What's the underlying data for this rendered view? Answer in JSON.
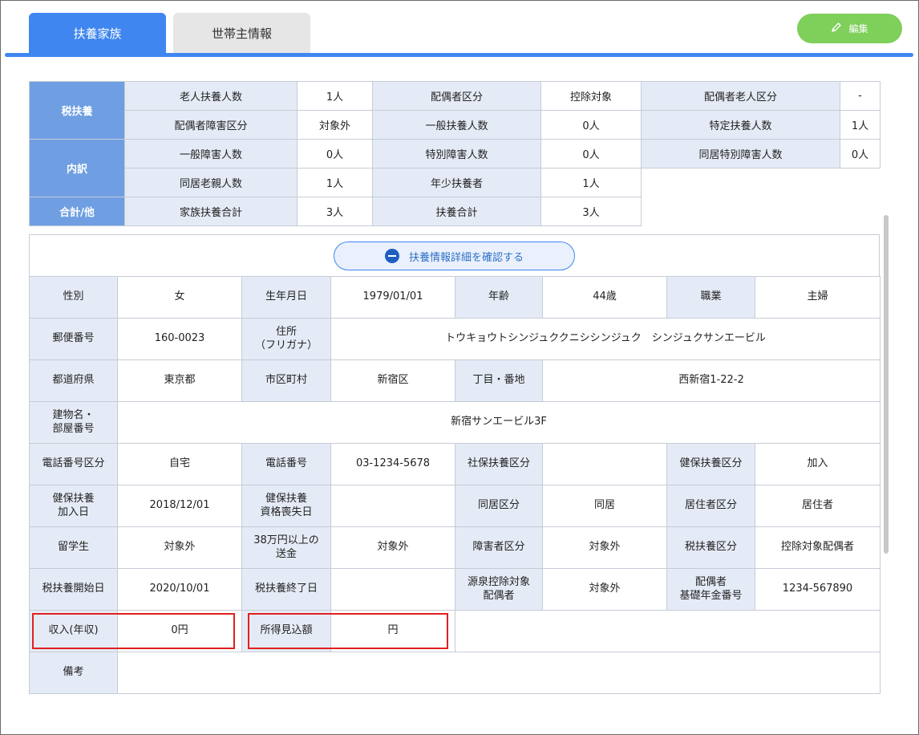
{
  "tabs": [
    {
      "label": "扶養家族"
    },
    {
      "label": "世帯主情報"
    }
  ],
  "edit_button": {
    "label": "編集"
  },
  "summary": {
    "categories": [
      "税扶養",
      "内訳",
      "合計/他"
    ],
    "rows": [
      [
        {
          "label": "老人扶養人数",
          "value": "1人"
        },
        {
          "label": "配偶者区分",
          "value": "控除対象"
        },
        {
          "label": "配偶者老人区分",
          "value": "-"
        }
      ],
      [
        {
          "label": "配偶者障害区分",
          "value": "対象外"
        },
        {
          "label": "一般扶養人数",
          "value": "0人"
        },
        {
          "label": "特定扶養人数",
          "value": "1人"
        }
      ],
      [
        {
          "label": "一般障害人数",
          "value": "0人"
        },
        {
          "label": "特別障害人数",
          "value": "0人"
        },
        {
          "label": "同居特別障害人数",
          "value": "0人"
        }
      ],
      [
        {
          "label": "同居老親人数",
          "value": "1人"
        },
        {
          "label": "年少扶養者",
          "value": "1人"
        }
      ],
      [
        {
          "label": "家族扶養合計",
          "value": "3人"
        },
        {
          "label": "扶養合計",
          "value": "3人"
        }
      ]
    ]
  },
  "detail_toggle": {
    "label": "扶養情報詳細を確認する"
  },
  "details": {
    "gender_label": "性別",
    "gender": "女",
    "birthdate_label": "生年月日",
    "birthdate": "1979/01/01",
    "age_label": "年齢",
    "age": "44歳",
    "occupation_label": "職業",
    "occupation": "主婦",
    "postal_label": "郵便番号",
    "postal": "160-0023",
    "address_kana_label_1": "住所",
    "address_kana_label_2": "（フリガナ）",
    "address_kana": "トウキョウトシンジュククニシシンジュク　シンジュクサンエービル",
    "prefecture_label": "都道府県",
    "prefecture": "東京都",
    "city_label": "市区町村",
    "city": "新宿区",
    "street_label": "丁目・番地",
    "street": "西新宿1-22-2",
    "building_label_1": "建物名・",
    "building_label_2": "部屋番号",
    "building": "新宿サンエービル3F",
    "phone_type_label": "電話番号区分",
    "phone_type": "自宅",
    "phone_label": "電話番号",
    "phone": "03-1234-5678",
    "social_ins_label": "社保扶養区分",
    "social_ins": "",
    "health_ins_label": "健保扶養区分",
    "health_ins": "加入",
    "health_join_label_1": "健保扶養",
    "health_join_label_2": "加入日",
    "health_join": "2018/12/01",
    "health_loss_label_1": "健保扶養",
    "health_loss_label_2": "資格喪失日",
    "health_loss": "",
    "cohab_label": "同居区分",
    "cohab": "同居",
    "resident_label": "居住者区分",
    "resident": "居住者",
    "student_label": "留学生",
    "student": "対象外",
    "remit_label_1": "38万円以上の",
    "remit_label_2": "送金",
    "remit": "対象外",
    "disability_label": "障害者区分",
    "disability": "対象外",
    "tax_dep_label": "税扶養区分",
    "tax_dep": "控除対象配偶者",
    "tax_start_label": "税扶養開始日",
    "tax_start": "2020/10/01",
    "tax_end_label": "税扶養終了日",
    "tax_end": "",
    "withholding_label_1": "源泉控除対象",
    "withholding_label_2": "配偶者",
    "withholding": "対象外",
    "pension_label_1": "配偶者",
    "pension_label_2": "基礎年金番号",
    "pension": "1234-567890",
    "income_label": "収入(年収)",
    "income": "0円",
    "expected_income_label": "所得見込額",
    "expected_income": "円",
    "remarks_label": "備考",
    "remarks": ""
  }
}
